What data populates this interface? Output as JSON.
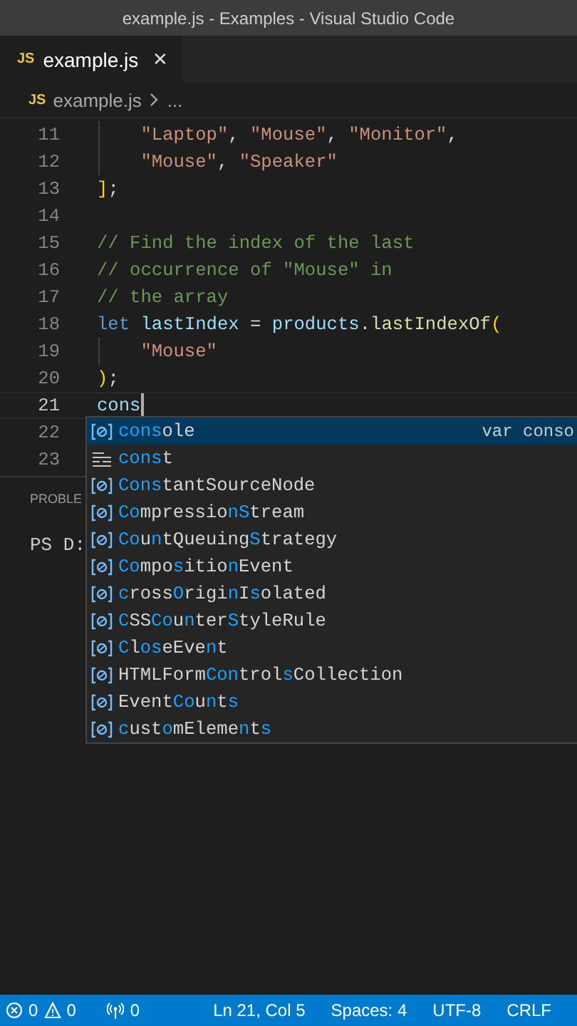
{
  "window": {
    "title": "example.js - Examples - Visual Studio Code"
  },
  "tabs": [
    {
      "icon_text": "JS",
      "label": "example.js",
      "selected": true,
      "close": "✕"
    }
  ],
  "breadcrumb": {
    "icon_text": "JS",
    "items": [
      "example.js",
      "..."
    ]
  },
  "editor": {
    "lines": [
      {
        "number": "11",
        "current": false,
        "indented": true,
        "tokens": [
          {
            "kind": "string",
            "text": "\"Laptop\""
          },
          {
            "kind": "plain",
            "text": ", "
          },
          {
            "kind": "string",
            "text": "\"Mouse\""
          },
          {
            "kind": "plain",
            "text": ", "
          },
          {
            "kind": "string",
            "text": "\"Monitor\""
          },
          {
            "kind": "plain",
            "text": ","
          }
        ]
      },
      {
        "number": "12",
        "current": false,
        "indented": true,
        "tokens": [
          {
            "kind": "string",
            "text": "\"Mouse\""
          },
          {
            "kind": "plain",
            "text": ", "
          },
          {
            "kind": "string",
            "text": "\"Speaker\""
          }
        ]
      },
      {
        "number": "13",
        "current": false,
        "indented": false,
        "tokens": [
          {
            "kind": "bracket",
            "text": "]"
          },
          {
            "kind": "plain",
            "text": ";"
          }
        ]
      },
      {
        "number": "14",
        "current": false,
        "indented": false
      },
      {
        "number": "15",
        "current": false,
        "indented": false,
        "tokens": [
          {
            "kind": "comment",
            "text": "// Find the index of the last"
          }
        ]
      },
      {
        "number": "16",
        "current": false,
        "indented": false,
        "tokens": [
          {
            "kind": "comment",
            "text": "// occurrence of \"Mouse\" in"
          }
        ]
      },
      {
        "number": "17",
        "current": false,
        "indented": false,
        "tokens": [
          {
            "kind": "comment",
            "text": "// the array"
          }
        ]
      },
      {
        "number": "18",
        "current": false,
        "indented": false,
        "tokens": [
          {
            "kind": "keyword",
            "text": "let"
          },
          {
            "kind": "variable",
            "text": " lastIndex"
          },
          {
            "kind": "plain",
            "text": " = "
          },
          {
            "kind": "variable",
            "text": "products"
          },
          {
            "kind": "plain",
            "text": "."
          },
          {
            "kind": "function",
            "text": "lastIndexOf"
          },
          {
            "kind": "bracket",
            "text": "("
          }
        ]
      },
      {
        "number": "19",
        "current": false,
        "indented": true,
        "tokens": [
          {
            "kind": "string",
            "text": "\"Mouse\""
          }
        ]
      },
      {
        "number": "20",
        "current": false,
        "indented": false,
        "tokens": [
          {
            "kind": "bracket",
            "text": ")"
          },
          {
            "kind": "plain",
            "text": ";"
          }
        ]
      },
      {
        "number": "21",
        "current": true,
        "indented": false,
        "tokens": [
          {
            "kind": "variable",
            "text": "cons"
          }
        ]
      },
      {
        "number": "22",
        "current": false
      },
      {
        "number": "23",
        "current": false
      }
    ]
  },
  "suggestions": [
    {
      "kind": "variable",
      "label": "**cons**ole",
      "selected": true,
      "detail": "var conso"
    },
    {
      "kind": "keyword",
      "label": "**cons**t",
      "selected": false
    },
    {
      "kind": "variable",
      "label": "**Cons**tantSourceNode",
      "selected": false
    },
    {
      "kind": "variable",
      "label": "**Co**mpressio**nS**tream",
      "selected": false
    },
    {
      "kind": "variable",
      "label": "**Co**u**n**tQueuing**S**trategy",
      "selected": false
    },
    {
      "kind": "variable",
      "label": "**Co**mpo**s**itio**n**Event",
      "selected": false
    },
    {
      "kind": "variable",
      "label": "**c**ross**O**rigi**n**I**s**olated",
      "selected": false
    },
    {
      "kind": "variable",
      "label": "**C**SS**Co**u**n**ter**S**tyleRule",
      "selected": false
    },
    {
      "kind": "variable",
      "label": "**C**l**os**eEve**n**t",
      "selected": false
    },
    {
      "kind": "variable",
      "label": "HTMLForm**Con**trol**s**Collection",
      "selected": false
    },
    {
      "kind": "variable",
      "label": "Event**Co**u**n**t**s**",
      "selected": false
    },
    {
      "kind": "variable",
      "label": "**c**ust**o**mEleme**n**t**s**",
      "selected": false
    }
  ],
  "panel": {
    "tab": "PROBLE",
    "terminal": "PS D:"
  },
  "status_bar": {
    "errors": "0",
    "warnings": "0",
    "ports": "0",
    "position": "Ln 21, Col 5",
    "indent": "Spaces: 4",
    "encoding": "UTF-8",
    "eol": "CRLF"
  }
}
